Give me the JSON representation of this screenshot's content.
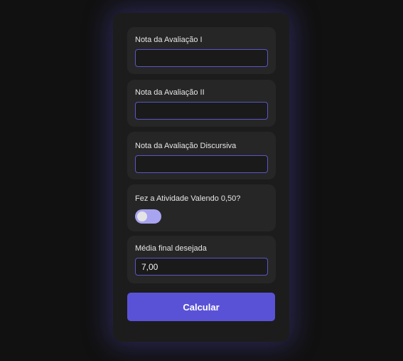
{
  "form": {
    "fields": [
      {
        "label": "Nota da Avaliação I",
        "value": "",
        "placeholder": ""
      },
      {
        "label": "Nota da Avaliação II",
        "value": "",
        "placeholder": ""
      },
      {
        "label": "Nota da Avaliação Discursiva",
        "value": "",
        "placeholder": ""
      }
    ],
    "activity": {
      "label": "Fez a Atividade Valendo 0,50?",
      "checked": false
    },
    "desired_average": {
      "label": "Média final desejada",
      "value": "7,00"
    },
    "submit_label": "Calcular"
  },
  "colors": {
    "background": "#111111",
    "card": "#1c1c1c",
    "field_box": "#262626",
    "accent": "#5a52d6",
    "input_border": "#5a55c8",
    "toggle_track": "#a9a4f0"
  }
}
